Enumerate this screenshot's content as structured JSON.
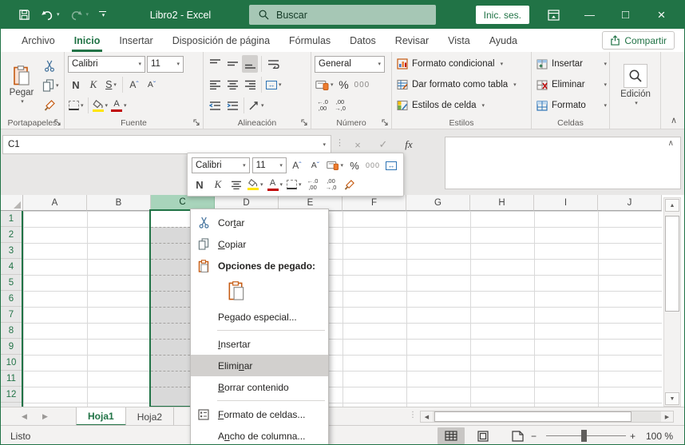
{
  "colors": {
    "accent": "#217346",
    "titlebar": "#217346",
    "search_bg": "#a6c7b5",
    "selected_column_header_bg": "#a8d4bb",
    "selection_fill": "#d9d9d9",
    "menu_highlight": "#d2d0ce",
    "fill_yellow": "#ffe500",
    "font_red": "#c00000",
    "clipboard_orange": "#c55a11",
    "office_blue": "#2b579a"
  },
  "titlebar": {
    "title": "Libro2 - Excel",
    "search_placeholder": "Buscar",
    "signin": "Inic. ses."
  },
  "tabs": {
    "share": "Compartir",
    "items": [
      {
        "label": "Archivo",
        "active": false
      },
      {
        "label": "Inicio",
        "active": true
      },
      {
        "label": "Insertar",
        "active": false
      },
      {
        "label": "Disposición de página",
        "active": false
      },
      {
        "label": "Fórmulas",
        "active": false
      },
      {
        "label": "Datos",
        "active": false
      },
      {
        "label": "Revisar",
        "active": false
      },
      {
        "label": "Vista",
        "active": false
      },
      {
        "label": "Ayuda",
        "active": false
      }
    ]
  },
  "ribbon": {
    "groups": [
      "Portapapeles",
      "Fuente",
      "Alineación",
      "Número",
      "Estilos",
      "Celdas",
      "Edición"
    ],
    "paste": "Pegar",
    "font_name": "Calibri",
    "font_size": "11",
    "bold": "N",
    "italic": "K",
    "underline": "S",
    "font_letter": "A",
    "number_format": "General",
    "percent": "%",
    "thousands": "000",
    "styles": [
      "Formato condicional",
      "Dar formato como tabla",
      "Estilos de celda"
    ],
    "cells": [
      "Insertar",
      "Eliminar",
      "Formato"
    ],
    "edit": "Edición"
  },
  "formula_bar": {
    "name_box": "C1",
    "fx": "fx"
  },
  "mini_toolbar": {
    "font_name": "Calibri",
    "font_size": "11"
  },
  "context_menu": {
    "items": [
      {
        "type": "item",
        "label": "Cortar",
        "accel": "t",
        "icon": "scissors"
      },
      {
        "type": "item",
        "label": "Copiar",
        "accel": "C",
        "icon": "copy"
      },
      {
        "type": "header",
        "label": "Opciones de pegado:",
        "icon": "clipboard"
      },
      {
        "type": "paste-option",
        "icon": "paste"
      },
      {
        "type": "item",
        "label": "Pegado especial...",
        "accel": "g"
      },
      {
        "type": "separator"
      },
      {
        "type": "item",
        "label": "Insertar",
        "accel": "I"
      },
      {
        "type": "item",
        "label": "Eliminar",
        "accel": "n",
        "highlighted": true
      },
      {
        "type": "item",
        "label": "Borrar contenido",
        "accel": "B"
      },
      {
        "type": "separator"
      },
      {
        "type": "item",
        "label": "Formato de celdas...",
        "accel": "F",
        "icon": "format-cells"
      },
      {
        "type": "item",
        "label": "Ancho de columna...",
        "accel": "n"
      }
    ]
  },
  "grid": {
    "columns": [
      "A",
      "B",
      "C",
      "D",
      "E",
      "F",
      "G",
      "H",
      "I",
      "J"
    ],
    "rows": [
      "1",
      "2",
      "3",
      "4",
      "5",
      "6",
      "7",
      "8",
      "9",
      "10",
      "11",
      "12"
    ],
    "selected_column": "C",
    "active_cell": "C1"
  },
  "sheet_bar": {
    "tabs": [
      {
        "label": "Hoja1",
        "active": true
      },
      {
        "label": "Hoja2",
        "active": false
      }
    ]
  },
  "status_bar": {
    "status": "Listo",
    "zoom": "100 %"
  },
  "glyphs": {
    "dd": "▾",
    "check": "✓",
    "close": "×",
    "maximize": "□",
    "minimize": "—",
    "collapse": "∧",
    "dots": "⋮",
    "up": "▲",
    "down": "▼",
    "left": "◀",
    "right": "▶",
    "caret_up": "ˆ",
    "caret_down": "ˇ",
    "arrow_both": "↔",
    "dec_add_top": "←.0",
    "dec_add_bot": ",00",
    "dec_rem_top": ",00",
    "dec_rem_bot": "→,0",
    "minus": "−",
    "plus": "+"
  }
}
